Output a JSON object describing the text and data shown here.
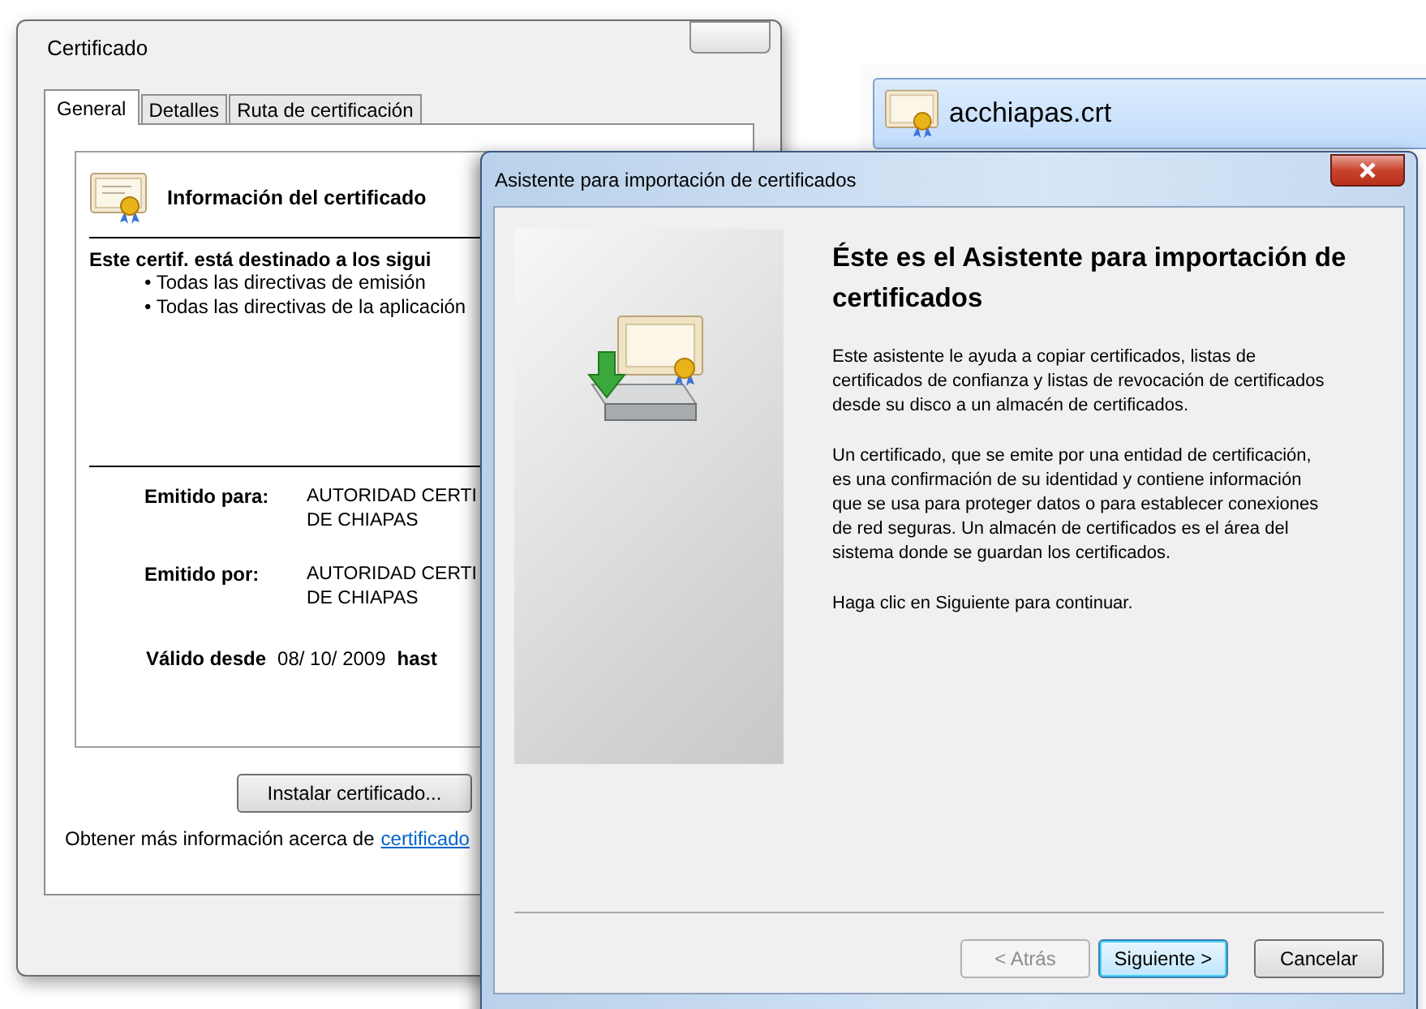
{
  "certificate_window": {
    "title": "Certificado",
    "tabs": [
      {
        "label": "General",
        "selected": true
      },
      {
        "label": "Detalles",
        "selected": false
      },
      {
        "label": "Ruta de certificación",
        "selected": false
      }
    ],
    "info_heading": "Información del certificado",
    "purpose_heading": "Este certif. está destinado a los sigui",
    "purposes": [
      "• Todas las directivas de emisión",
      "• Todas las directivas de la aplicación"
    ],
    "fields": [
      {
        "label": "Emitido para:",
        "value_lines": [
          "AUTORIDAD CERTI",
          "DE CHIAPAS"
        ]
      },
      {
        "label": "Emitido por:",
        "value_lines": [
          "AUTORIDAD CERTI",
          "DE CHIAPAS"
        ]
      }
    ],
    "validity": {
      "label": "Válido desde",
      "from": "08/ 10/ 2009",
      "to_label": "hast"
    },
    "install_button": "Instalar certificado...",
    "more_info": {
      "text": "Obtener más información acerca de",
      "link": "certificado"
    }
  },
  "file_item": {
    "name": "acchiapas.crt",
    "selected": true
  },
  "wizard": {
    "title": "Asistente para importación de certificados",
    "heading": "Éste es el Asistente para importación de certificados",
    "paragraphs": [
      "Este asistente le ayuda a copiar certificados, listas de certificados de confianza y listas de revocación de certificados desde su disco a un almacén de certificados.",
      "Un certificado, que se emite por una entidad de certificación, es una confirmación de su identidad y contiene información que se usa para proteger datos o para establecer conexiones de red seguras. Un almacén de certificados es el área del sistema donde se guardan los certificados.",
      "Haga clic en Siguiente para continuar."
    ],
    "buttons": [
      {
        "label": "< Atrás",
        "disabled": true,
        "default": false
      },
      {
        "label": "Siguiente >",
        "disabled": false,
        "default": true
      },
      {
        "label": "Cancelar",
        "disabled": false,
        "default": false
      }
    ]
  }
}
